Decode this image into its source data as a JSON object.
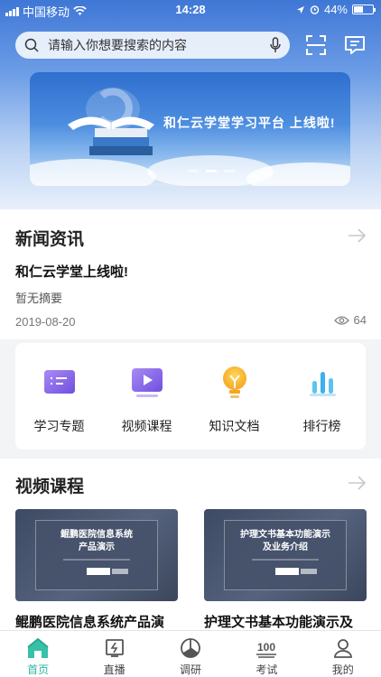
{
  "status": {
    "carrier": "中国移动",
    "time": "14:28",
    "battery": "44%"
  },
  "search": {
    "placeholder": "请输入你想要搜索的内容"
  },
  "banner": {
    "title": "和仁云学堂学习平台 上线啦!",
    "slide_count": 3,
    "active_slide": 1
  },
  "news": {
    "section_title": "新闻资讯",
    "headline": "和仁云学堂上线啦!",
    "summary": "暂无摘要",
    "date": "2019-08-20",
    "views": "64"
  },
  "quick_menu": [
    {
      "label": "学习专题",
      "icon": "topic-icon"
    },
    {
      "label": "视频课程",
      "icon": "video-play-icon"
    },
    {
      "label": "知识文档",
      "icon": "lightbulb-icon"
    },
    {
      "label": "排行榜",
      "icon": "ranking-bars-icon"
    }
  ],
  "videos": {
    "section_title": "视频课程",
    "items": [
      {
        "thumb_title": "鲲鹏医院信息系统\n产品演示",
        "title": "鲲鹏医院信息系统产品演"
      },
      {
        "thumb_title": "护理文书基本功能演示\n及业务介绍",
        "title": "护理文书基本功能演示及"
      }
    ]
  },
  "tabbar": [
    {
      "label": "首页",
      "icon": "home-icon",
      "active": true
    },
    {
      "label": "直播",
      "icon": "live-icon",
      "active": false
    },
    {
      "label": "调研",
      "icon": "survey-pie-icon",
      "active": false
    },
    {
      "label": "考试",
      "icon": "exam-100-icon",
      "active": false
    },
    {
      "label": "我的",
      "icon": "profile-icon",
      "active": false
    }
  ],
  "colors": {
    "accent": "#2bb6a0",
    "hero_top": "#3f77d6"
  }
}
